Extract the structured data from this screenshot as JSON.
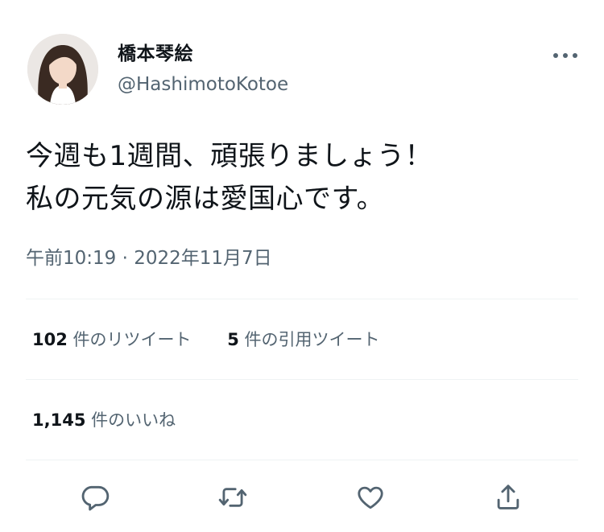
{
  "tweet": {
    "author": {
      "display_name": "橋本琴絵",
      "handle": "@HashimotoKotoe"
    },
    "text_lines": [
      "今週も1週間、頑張りましょう！",
      "私の元気の源は愛国心です。"
    ],
    "timestamp": "午前10:19 · 2022年11月7日",
    "stats": {
      "retweets": {
        "count": "102",
        "label": "件のリツイート"
      },
      "quotes": {
        "count": "5",
        "label": "件の引用ツイート"
      },
      "likes": {
        "count": "1,145",
        "label": "件のいいね"
      }
    }
  },
  "icons": {
    "more": "more-horizontal-icon",
    "reply": "reply-icon",
    "retweet": "retweet-icon",
    "like": "heart-icon",
    "share": "share-icon"
  },
  "colors": {
    "primary_text": "#0f1419",
    "secondary_text": "#536471",
    "divider": "#eff3f4"
  }
}
